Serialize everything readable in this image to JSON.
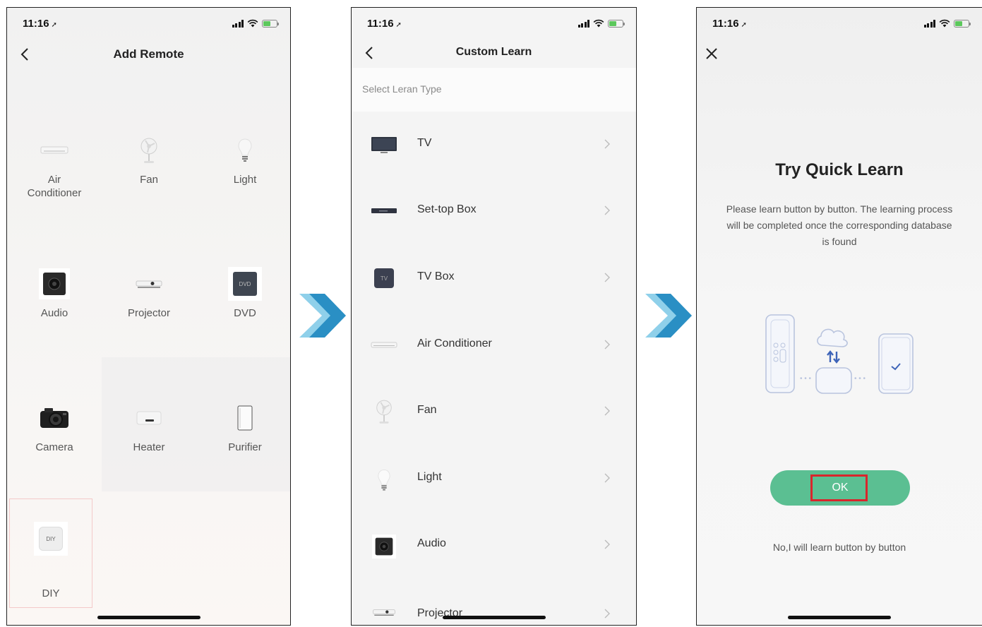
{
  "status": {
    "time": "11:16",
    "location_glyph": "➚"
  },
  "colors": {
    "accent_green": "#5bbf92",
    "highlight_red": "#d9262c",
    "arrow_blue": "#2a8fc4"
  },
  "screen1": {
    "title": "Add Remote",
    "items": [
      {
        "label": "Air\nConditioner",
        "icon": "air-conditioner-icon"
      },
      {
        "label": "Fan",
        "icon": "fan-icon"
      },
      {
        "label": "Light",
        "icon": "light-bulb-icon"
      },
      {
        "label": "Audio",
        "icon": "speaker-icon"
      },
      {
        "label": "Projector",
        "icon": "projector-icon"
      },
      {
        "label": "DVD",
        "icon": "dvd-icon"
      },
      {
        "label": "Camera",
        "icon": "camera-icon"
      },
      {
        "label": "Heater",
        "icon": "heater-icon"
      },
      {
        "label": "Purifier",
        "icon": "purifier-icon"
      },
      {
        "label": "DIY",
        "icon": "diy-icon"
      }
    ],
    "diy_icon_text": "DIY",
    "dvd_icon_text": "DVD"
  },
  "screen2": {
    "title": "Custom Learn",
    "section_header": "Select Leran Type",
    "items": [
      {
        "label": "TV",
        "icon": "tv-icon"
      },
      {
        "label": "Set-top Box",
        "icon": "set-top-box-icon"
      },
      {
        "label": "TV Box",
        "icon": "tv-box-icon"
      },
      {
        "label": "Air Conditioner",
        "icon": "air-conditioner-icon"
      },
      {
        "label": "Fan",
        "icon": "fan-icon"
      },
      {
        "label": "Light",
        "icon": "light-bulb-icon"
      },
      {
        "label": "Audio",
        "icon": "speaker-icon"
      },
      {
        "label": "Projector",
        "icon": "projector-icon"
      }
    ],
    "tv_box_icon_text": "TV"
  },
  "screen3": {
    "title": "Try Quick Learn",
    "description": "Please learn button by button. The learning process will be completed once the corresponding database is found",
    "ok_label": "OK",
    "alt_label": "No,I will learn button by button"
  }
}
